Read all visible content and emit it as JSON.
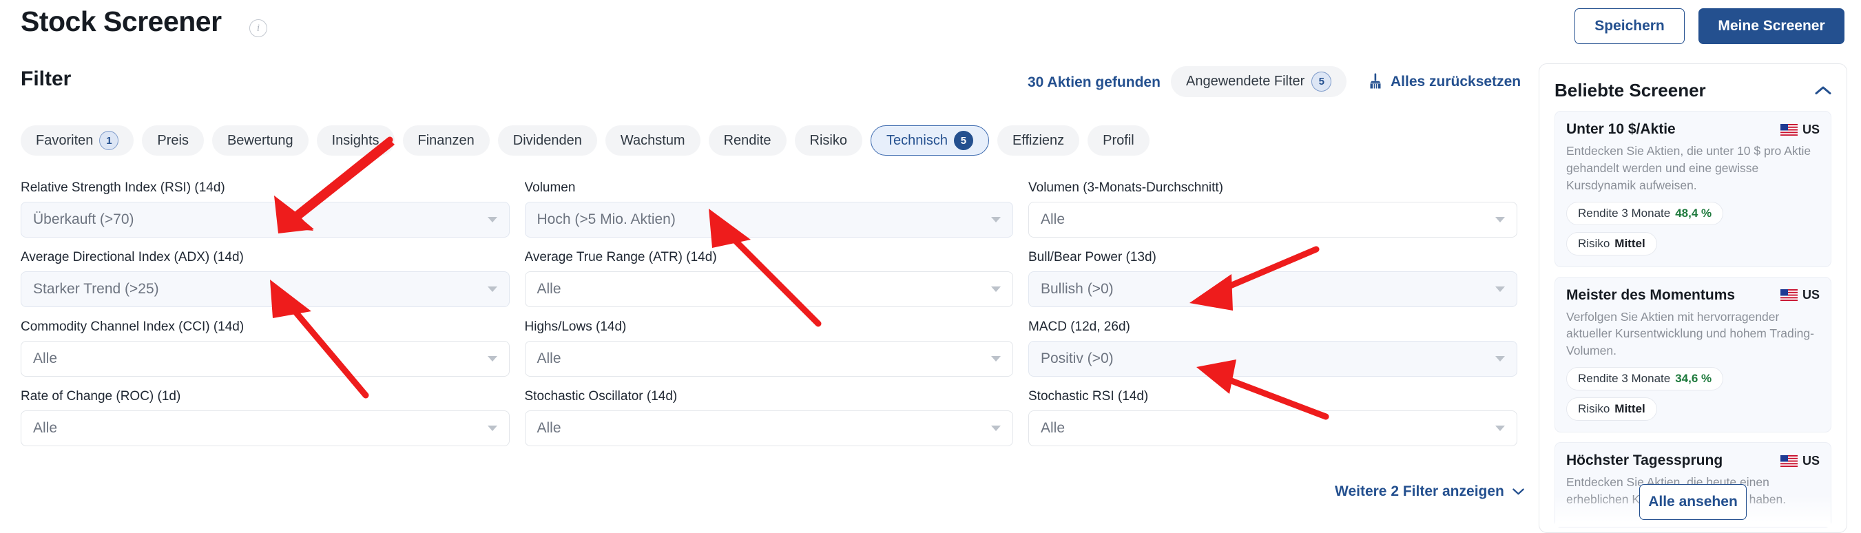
{
  "header": {
    "title": "Stock Screener",
    "info_icon": "info-icon",
    "save_label": "Speichern",
    "my_screeners_label": "Meine Screener"
  },
  "filter_bar": {
    "title": "Filter",
    "results_count": "30 Aktien gefunden",
    "applied_filters_label": "Angewendete Filter",
    "applied_filters_count": "5",
    "reset_label": "Alles zurücksetzen",
    "reset_icon": "broom-icon"
  },
  "tabs": [
    {
      "label": "Favoriten",
      "badge": "1",
      "active": false
    },
    {
      "label": "Preis",
      "badge": "",
      "active": false
    },
    {
      "label": "Bewertung",
      "badge": "",
      "active": false
    },
    {
      "label": "Insights",
      "badge": "",
      "active": false
    },
    {
      "label": "Finanzen",
      "badge": "",
      "active": false
    },
    {
      "label": "Dividenden",
      "badge": "",
      "active": false
    },
    {
      "label": "Wachstum",
      "badge": "",
      "active": false
    },
    {
      "label": "Rendite",
      "badge": "",
      "active": false
    },
    {
      "label": "Risiko",
      "badge": "",
      "active": false
    },
    {
      "label": "Technisch",
      "badge": "5",
      "active": true
    },
    {
      "label": "Effizienz",
      "badge": "",
      "active": false
    },
    {
      "label": "Profil",
      "badge": "",
      "active": false
    }
  ],
  "filters": [
    {
      "label": "Relative Strength Index (RSI) (14d)",
      "value": "Überkauft (>70)",
      "filled": true
    },
    {
      "label": "Volumen",
      "value": "Hoch (>5 Mio. Aktien)",
      "filled": true
    },
    {
      "label": "Volumen (3-Monats-Durchschnitt)",
      "value": "Alle",
      "filled": false
    },
    {
      "label": "Average Directional Index (ADX) (14d)",
      "value": "Starker Trend (>25)",
      "filled": true
    },
    {
      "label": "Average True Range (ATR) (14d)",
      "value": "Alle",
      "filled": false
    },
    {
      "label": "Bull/Bear Power (13d)",
      "value": "Bullish (>0)",
      "filled": true
    },
    {
      "label": "Commodity Channel Index (CCI) (14d)",
      "value": "Alle",
      "filled": false
    },
    {
      "label": "Highs/Lows (14d)",
      "value": "Alle",
      "filled": false
    },
    {
      "label": "MACD (12d, 26d)",
      "value": "Positiv (>0)",
      "filled": true
    },
    {
      "label": "Rate of Change (ROC) (1d)",
      "value": "Alle",
      "filled": false
    },
    {
      "label": "Stochastic Oscillator (14d)",
      "value": "Alle",
      "filled": false
    },
    {
      "label": "Stochastic RSI (14d)",
      "value": "Alle",
      "filled": false
    }
  ],
  "more_filters": {
    "label": "Weitere 2 Filter anzeigen",
    "icon": "chevron-down-icon"
  },
  "sidebar": {
    "title": "Beliebte Screener",
    "collapse_icon": "chevron-up-icon",
    "view_all_label": "Alle ansehen",
    "screeners": [
      {
        "name": "Unter 10 $/Aktie",
        "market": "US",
        "flag_icon": "us-flag-icon",
        "description": "Entdecken Sie Aktien, die unter 10 $ pro Aktie gehandelt werden und eine gewisse Kursdynamik aufweisen.",
        "tags": [
          {
            "label": "Rendite 3 Monate",
            "value": "48,4 %",
            "kind": "positive"
          },
          {
            "label": "Risiko",
            "value": "Mittel",
            "kind": "neutral"
          }
        ]
      },
      {
        "name": "Meister des Momentums",
        "market": "US",
        "flag_icon": "us-flag-icon",
        "description": "Verfolgen Sie Aktien mit hervorragender aktueller Kursentwicklung und hohem Trading-Volumen.",
        "tags": [
          {
            "label": "Rendite 3 Monate",
            "value": "34,6 %",
            "kind": "positive"
          },
          {
            "label": "Risiko",
            "value": "Mittel",
            "kind": "neutral"
          }
        ]
      },
      {
        "name": "Höchster Tagessprung",
        "market": "US",
        "flag_icon": "us-flag-icon",
        "description": "Entdecken Sie Aktien, die heute einen erheblichen Kurssprung hingelegt haben.",
        "tags": []
      }
    ]
  },
  "annotations": {
    "arrow_color": "#ee1c1c",
    "arrows": [
      {
        "target": "rsi-select"
      },
      {
        "target": "adx-select"
      },
      {
        "target": "volumen-select"
      },
      {
        "target": "bullbear-select"
      },
      {
        "target": "macd-select"
      }
    ]
  },
  "colors": {
    "accent": "#24508f",
    "positive": "#1f7a3d",
    "chip_bg": "#f3f4f6",
    "field_filled_bg": "#f6f8fc"
  }
}
